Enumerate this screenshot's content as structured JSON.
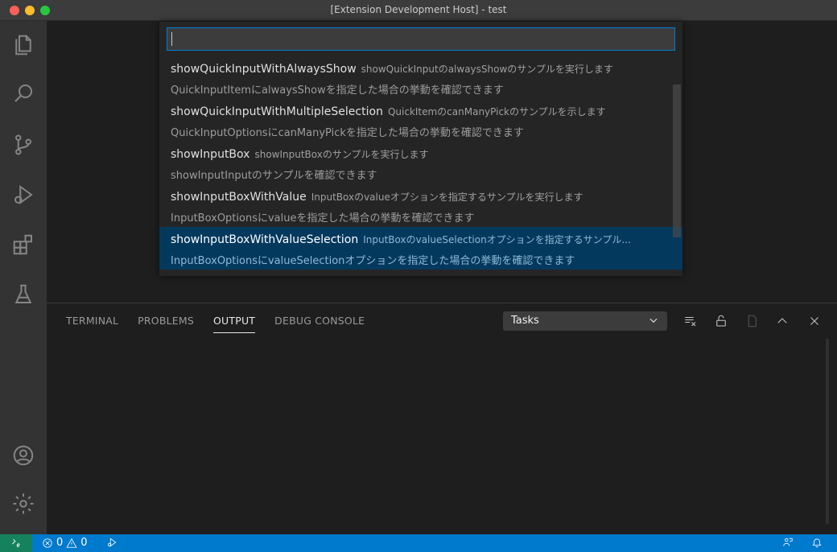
{
  "window": {
    "title": "[Extension Development Host] - test"
  },
  "activity_bar": {
    "icons": [
      "files-icon",
      "search-icon",
      "source-control-icon",
      "run-debug-icon",
      "extensions-icon",
      "testing-icon",
      "account-icon",
      "settings-gear-icon"
    ]
  },
  "quick_pick": {
    "input_value": "",
    "items": [
      {
        "label": "showQuickInputWithAlwaysShow",
        "description": "showQuickInputのalwaysShowのサンプルを実行します",
        "detail": "QuickInputItemにalwaysShowを指定した場合の挙動を確認できます"
      },
      {
        "label": "showQuickInputWithMultipleSelection",
        "description": "QuickItemのcanManyPickのサンプルを示します",
        "detail": "QuickInputOptionsにcanManyPickを指定した場合の挙動を確認できます"
      },
      {
        "label": "showInputBox",
        "description": "showInputBoxのサンプルを実行します",
        "detail": "showInputInputのサンプルを確認できます"
      },
      {
        "label": "showInputBoxWithValue",
        "description": "InputBoxのvalueオプションを指定するサンプルを実行します",
        "detail": "InputBoxOptionsにvalueを指定した場合の挙動を確認できます"
      },
      {
        "label": "showInputBoxWithValueSelection",
        "description": "InputBoxのvalueSelectionオプションを指定するサンプル...",
        "detail": "InputBoxOptionsにvalueSelectionオプションを指定した場合の挙動を確認できます"
      }
    ]
  },
  "panel": {
    "tabs": [
      "TERMINAL",
      "PROBLEMS",
      "OUTPUT",
      "DEBUG CONSOLE"
    ],
    "active_tab": "OUTPUT",
    "output_channel": "Tasks"
  },
  "status_bar": {
    "errors": "0",
    "warnings": "0"
  },
  "colors": {
    "status_bar": "#007acc",
    "remote_indicator": "#16825d",
    "selection": "#04395e",
    "focus_border": "#007fd4"
  }
}
